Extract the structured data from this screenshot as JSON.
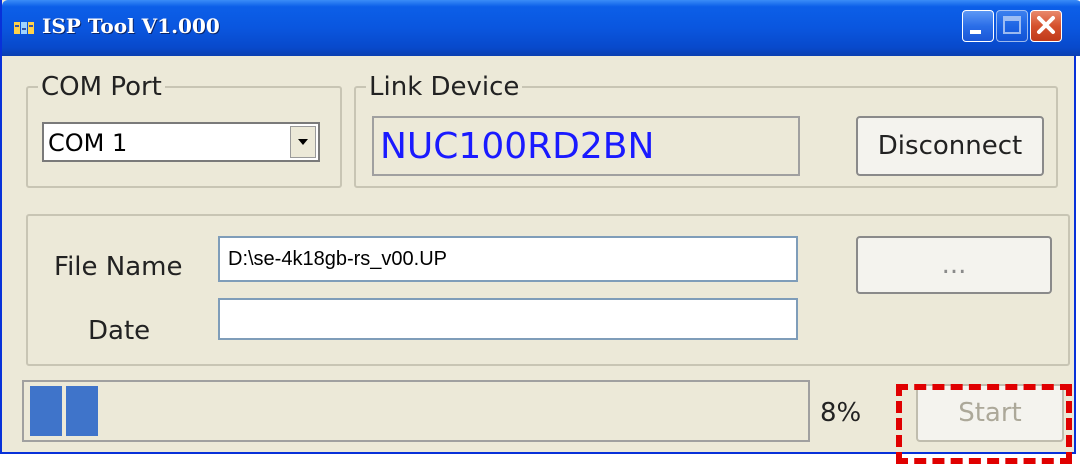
{
  "window": {
    "title": "ISP Tool V1.000",
    "app_icon": "isp-tool-icon",
    "controls": [
      "minimize-icon",
      "maximize-icon",
      "close-icon"
    ]
  },
  "com_port": {
    "legend": "COM Port",
    "selected": "COM 1"
  },
  "link_device": {
    "legend": "Link Device",
    "device_name": "NUC100RD2BN",
    "disconnect_label": "Disconnect"
  },
  "file": {
    "file_name_label": "File Name",
    "file_name_value": "D:\\se-4k18gb-rs_v00.UP",
    "date_label": "Date",
    "date_value": "",
    "browse_label": "..."
  },
  "status": {
    "progress_percent": 8,
    "progress_text": "8%",
    "start_label": "Start"
  },
  "colors": {
    "titlebar": "#0A56DF",
    "window_bg": "#ECE9D8",
    "device_text": "#1A1AFF",
    "progress_fill": "#3F74CA",
    "highlight": "#E00000"
  }
}
